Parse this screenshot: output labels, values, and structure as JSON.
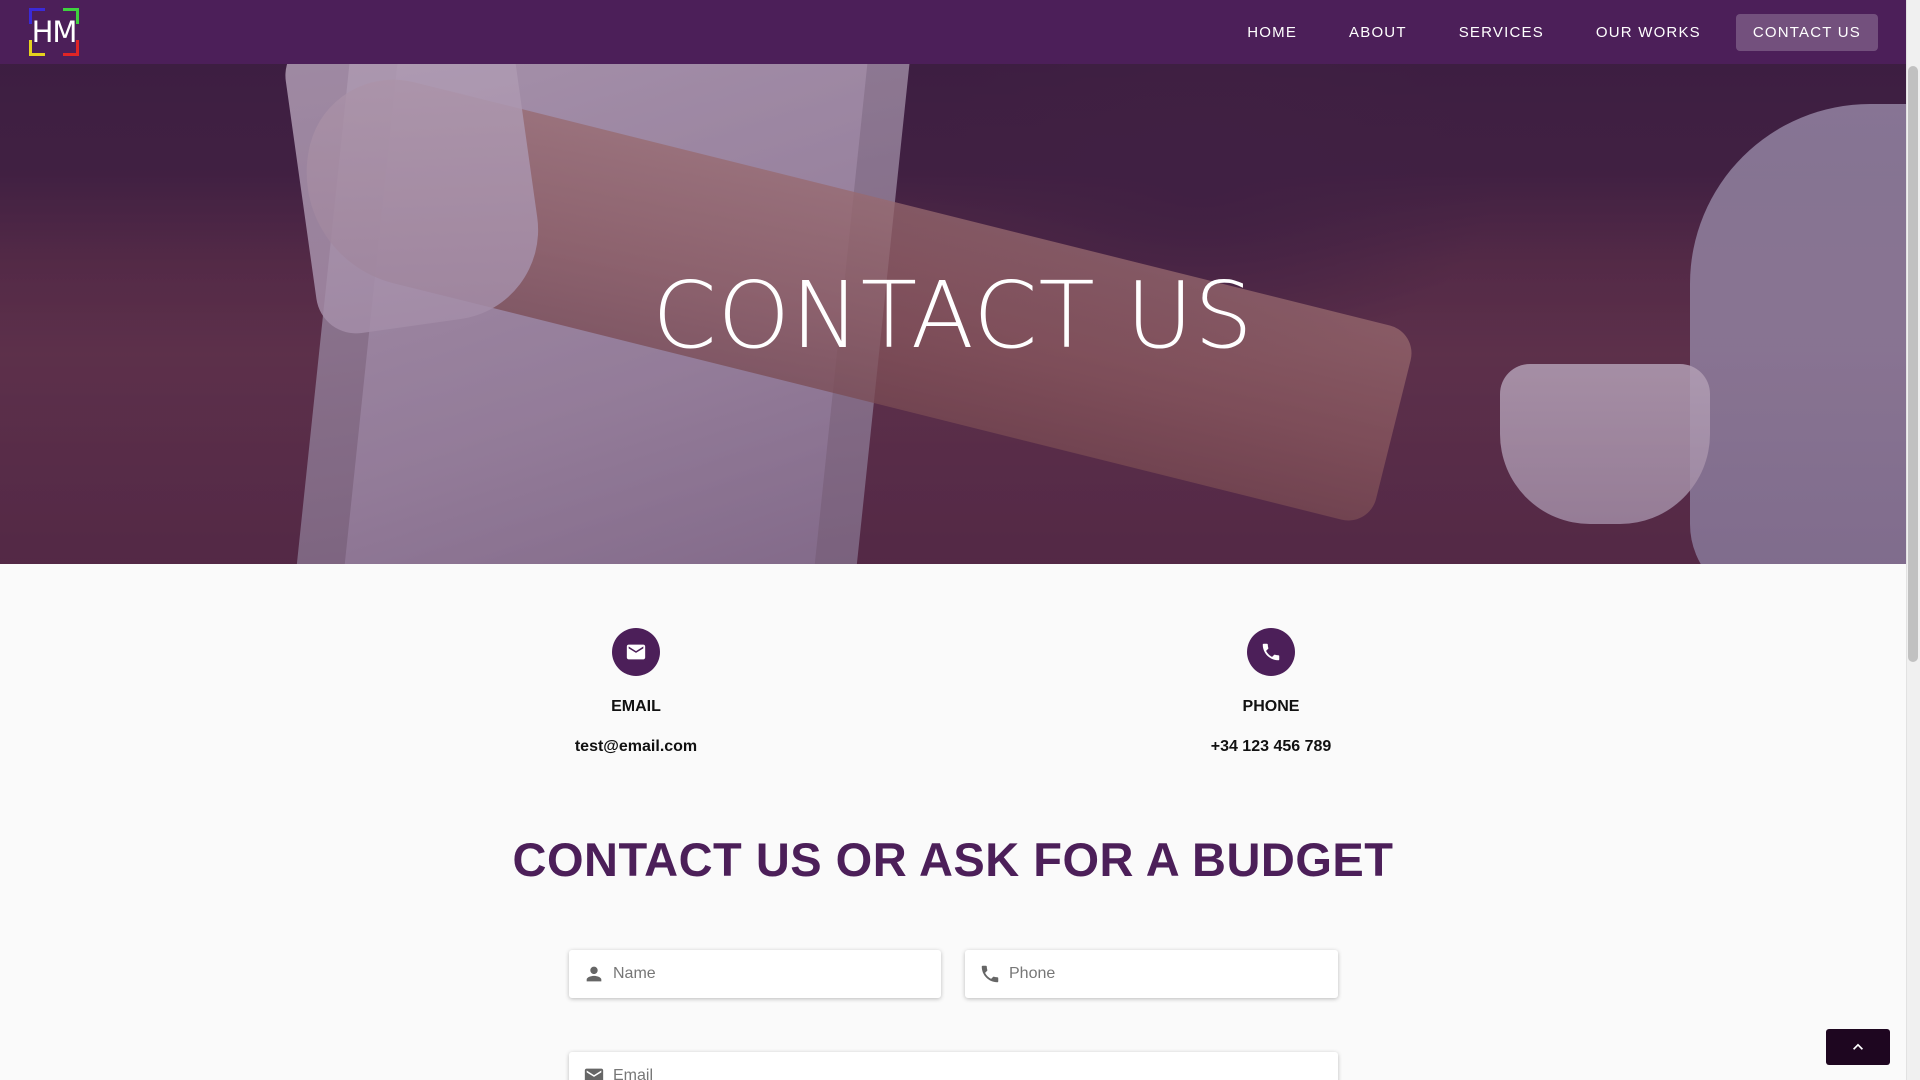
{
  "brand": {
    "logo_text": "HM"
  },
  "nav": {
    "items": [
      {
        "label": "HOME",
        "active": false
      },
      {
        "label": "ABOUT",
        "active": false
      },
      {
        "label": "SERVICES",
        "active": false
      },
      {
        "label": "OUR WORKS",
        "active": false
      },
      {
        "label": "CONTACT US",
        "active": true
      }
    ]
  },
  "hero": {
    "title": "CONTACT US"
  },
  "contact_info": {
    "email": {
      "icon": "mail-icon",
      "label": "EMAIL",
      "value": "test@email.com"
    },
    "phone": {
      "icon": "phone-icon",
      "label": "PHONE",
      "value": "+34 123 456 789"
    }
  },
  "form": {
    "title": "CONTACT US OR ASK FOR A BUDGET",
    "name_placeholder": "Name",
    "phone_placeholder": "Phone",
    "email_placeholder": "Email"
  },
  "colors": {
    "primary": "#4c1f59",
    "back_to_top": "#1e0620"
  }
}
